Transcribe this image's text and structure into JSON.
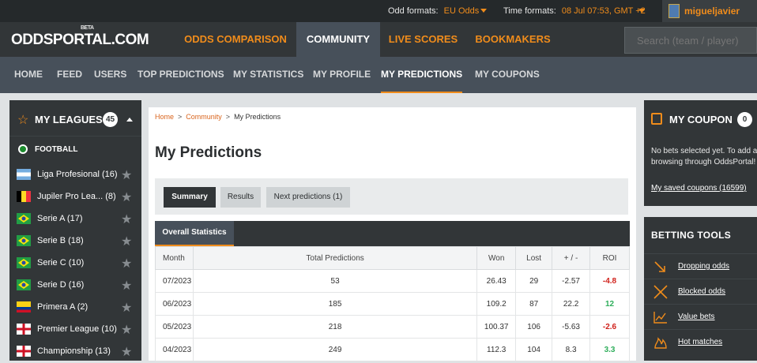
{
  "top_strip": {
    "odd_formats_label": "Odd formats:",
    "odd_formats_value": "EU Odds",
    "time_formats_label": "Time formats:",
    "time_formats_value": "08 Jul 07:53, GMT +2",
    "username": "migueljavier"
  },
  "main_nav": {
    "logo_text": "ODDSPORTAL.COM",
    "logo_badge": "BETA",
    "items": [
      "ODDS COMPARISON",
      "COMMUNITY",
      "LIVE SCORES",
      "BOOKMAKERS"
    ],
    "active_item": "COMMUNITY",
    "search_placeholder": "Search (team / player)"
  },
  "sub_nav": {
    "items": [
      "HOME",
      "FEED",
      "USERS",
      "TOP PREDICTIONS",
      "MY STATISTICS",
      "MY PROFILE",
      "MY PREDICTIONS",
      "MY COUPONS"
    ],
    "active_item": "MY PREDICTIONS"
  },
  "my_leagues": {
    "title": "MY LEAGUES",
    "count": "45",
    "sport": "FOOTBALL",
    "leagues": [
      {
        "name": "Liga Profesional (16)",
        "flag": "argentina"
      },
      {
        "name": "Jupiler Pro Lea...  (8)",
        "flag": "belgium"
      },
      {
        "name": "Serie A (17)",
        "flag": "brazil"
      },
      {
        "name": "Serie B (18)",
        "flag": "brazil"
      },
      {
        "name": "Serie C (10)",
        "flag": "brazil"
      },
      {
        "name": "Serie D (16)",
        "flag": "brazil"
      },
      {
        "name": "Primera A (2)",
        "flag": "colombia"
      },
      {
        "name": "Premier League (10)",
        "flag": "england"
      },
      {
        "name": "Championship (13)",
        "flag": "england"
      }
    ]
  },
  "breadcrumb": {
    "items": [
      "Home",
      "Community",
      "My Predictions"
    ],
    "separator": ">"
  },
  "page_title": "My Predictions",
  "tabs": [
    "Summary",
    "Results",
    "Next predictions (1)"
  ],
  "active_tab": "Summary",
  "overall_statistics": {
    "label": "Overall Statistics",
    "columns": [
      "Month",
      "Total Predictions",
      "Won",
      "Lost",
      "+ / -",
      "ROI"
    ],
    "rows": [
      {
        "month": "07/2023",
        "total": "53",
        "won": "26.43",
        "lost": "29",
        "pm": "-2.57",
        "roi": "-4.8",
        "roi_sign": "neg"
      },
      {
        "month": "06/2023",
        "total": "185",
        "won": "109.2",
        "lost": "87",
        "pm": "22.2",
        "roi": "12",
        "roi_sign": "pos"
      },
      {
        "month": "05/2023",
        "total": "218",
        "won": "100.37",
        "lost": "106",
        "pm": "-5.63",
        "roi": "-2.6",
        "roi_sign": "neg"
      },
      {
        "month": "04/2023",
        "total": "249",
        "won": "112.3",
        "lost": "104",
        "pm": "8.3",
        "roi": "3.3",
        "roi_sign": "pos"
      }
    ]
  },
  "my_coupon": {
    "title": "MY COUPON",
    "count": "0",
    "text_line1": "No bets selected yet. To add a",
    "text_line2": "browsing through OddsPortal!",
    "saved_link": "My saved coupons (16599)"
  },
  "betting_tools": {
    "title": "BETTING TOOLS",
    "items": [
      {
        "label": "Dropping odds",
        "icon": "dropping-odds-icon"
      },
      {
        "label": "Blocked odds",
        "icon": "blocked-odds-icon"
      },
      {
        "label": "Value bets",
        "icon": "value-bets-icon"
      },
      {
        "label": "Hot matches",
        "icon": "hot-matches-icon"
      }
    ]
  },
  "colors": {
    "accent": "#f08c1b",
    "nav_dark": "#323638",
    "nav_mid": "#47505a",
    "negative": "#d0211b",
    "positive": "#2fae5b"
  }
}
